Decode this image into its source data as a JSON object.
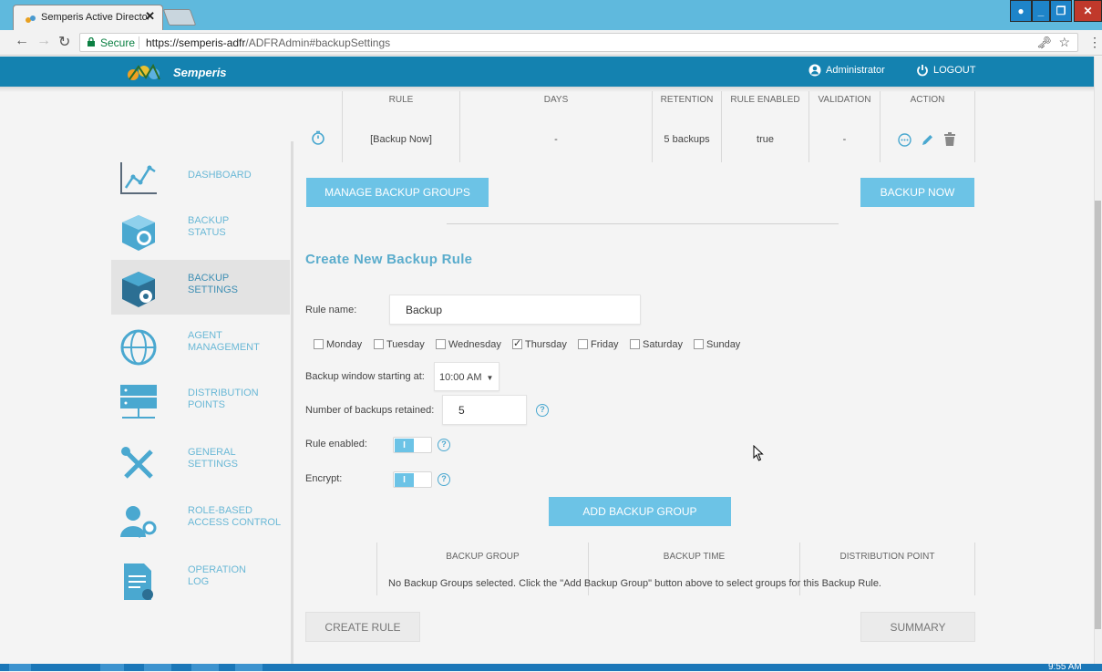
{
  "browser": {
    "tab_title": "Semperis Active Directory",
    "tab_close": "✕",
    "secure_label": "Secure",
    "url_host": "https://semperis-adfr",
    "url_path": "/ADFRAdmin#backupSettings"
  },
  "header": {
    "brand": "Semperis",
    "user": "Administrator",
    "logout": "LOGOUT",
    "colors": {
      "bar": "#1482b0",
      "accent": "#6cc3e6"
    }
  },
  "sidebar": {
    "items": [
      {
        "label": "DASHBOARD",
        "icon": "chart-line-icon",
        "active": false
      },
      {
        "label": "BACKUP\nSTATUS",
        "icon": "backup-status-icon",
        "active": false
      },
      {
        "label": "BACKUP\nSETTINGS",
        "icon": "backup-settings-icon",
        "active": true
      },
      {
        "label": "AGENT\nMANAGEMENT",
        "icon": "globe-icon",
        "active": false
      },
      {
        "label": "DISTRIBUTION\nPOINTS",
        "icon": "server-icon",
        "active": false
      },
      {
        "label": "GENERAL\nSETTINGS",
        "icon": "wrench-screwdriver-icon",
        "active": false
      },
      {
        "label": "ROLE-BASED\nACCESS CONTROL",
        "icon": "user-key-icon",
        "active": false
      },
      {
        "label": "OPERATION\nLOG",
        "icon": "log-document-icon",
        "active": false
      }
    ]
  },
  "rules_table": {
    "headers": [
      "RULE",
      "DAYS",
      "RETENTION",
      "RULE ENABLED",
      "VALIDATION",
      "ACTION"
    ],
    "row": {
      "rule": "[Backup Now]",
      "days": "-",
      "retention": "5 backups",
      "rule_enabled": "true",
      "validation": "-"
    }
  },
  "buttons": {
    "manage_groups": "MANAGE BACKUP GROUPS",
    "backup_now": "BACKUP NOW",
    "add_group": "ADD BACKUP GROUP",
    "create_rule": "CREATE RULE",
    "summary": "SUMMARY"
  },
  "form": {
    "title": "Create New Backup Rule",
    "rule_name_label": "Rule name:",
    "rule_name_value": "Backup",
    "days": [
      {
        "name": "Monday",
        "checked": false
      },
      {
        "name": "Tuesday",
        "checked": false
      },
      {
        "name": "Wednesday",
        "checked": false
      },
      {
        "name": "Thursday",
        "checked": true
      },
      {
        "name": "Friday",
        "checked": false
      },
      {
        "name": "Saturday",
        "checked": false
      },
      {
        "name": "Sunday",
        "checked": false
      }
    ],
    "window_label": "Backup window starting at:",
    "window_value": "10:00 AM",
    "retained_label": "Number of backups retained:",
    "retained_value": "5",
    "enabled_label": "Rule enabled:",
    "encrypt_label": "Encrypt:",
    "toggle_on": "I",
    "help_glyph": "?"
  },
  "groups_table": {
    "headers": [
      "BACKUP GROUP",
      "BACKUP TIME",
      "DISTRIBUTION POINT"
    ],
    "empty_message": "No Backup Groups selected. Click the \"Add Backup Group\" button above to select groups for this Backup Rule."
  },
  "taskbar": {
    "clock": "9:55 AM"
  }
}
